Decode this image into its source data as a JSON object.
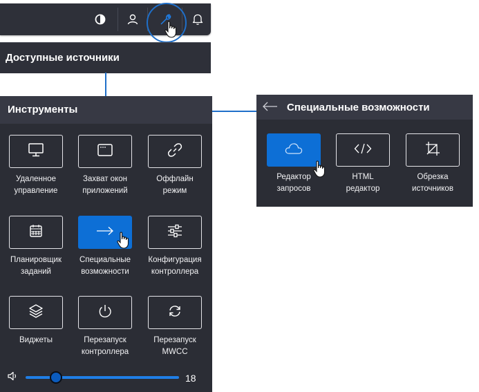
{
  "topbar": {
    "icons": [
      "contrast-icon",
      "user-icon",
      "wrench-icon",
      "bell-icon"
    ]
  },
  "sources": {
    "title": "Доступные источники"
  },
  "tools": {
    "title": "Инструменты",
    "items": [
      {
        "label_line1": "Удаленное",
        "label_line2": "управление",
        "icon": "monitor-icon"
      },
      {
        "label_line1": "Захват окон",
        "label_line2": "приложений",
        "icon": "window-icon"
      },
      {
        "label_line1": "Оффлайн",
        "label_line2": "режим",
        "icon": "link-icon"
      },
      {
        "label_line1": "Планировщик",
        "label_line2": "заданий",
        "icon": "calendar-icon"
      },
      {
        "label_line1": "Специальные",
        "label_line2": "возможности",
        "icon": "arrow-right-icon",
        "active": true
      },
      {
        "label_line1": "Конфигурация",
        "label_line2": "контроллера",
        "icon": "sliders-icon"
      },
      {
        "label_line1": "Виджеты",
        "label_line2": "",
        "icon": "layers-icon"
      },
      {
        "label_line1": "Перезапуск",
        "label_line2": "контроллера",
        "icon": "power-icon"
      },
      {
        "label_line1": "Перезапуск",
        "label_line2": "MWCC",
        "icon": "refresh-icon"
      }
    ]
  },
  "volume": {
    "value": "18",
    "level_fraction": 0.2
  },
  "accessibility": {
    "title": "Специальные возможности",
    "items": [
      {
        "label_line1": "Редактор",
        "label_line2": "запросов",
        "icon": "cloud-icon",
        "active": true
      },
      {
        "label_line1": "HTML",
        "label_line2": "редактор",
        "icon": "code-icon"
      },
      {
        "label_line1": "Обрезка",
        "label_line2": "источников",
        "icon": "crop-icon"
      }
    ]
  },
  "colors": {
    "accent": "#0d6fd6",
    "panel": "#2b2d35",
    "header": "#373944",
    "connector": "#1f6fc9"
  }
}
